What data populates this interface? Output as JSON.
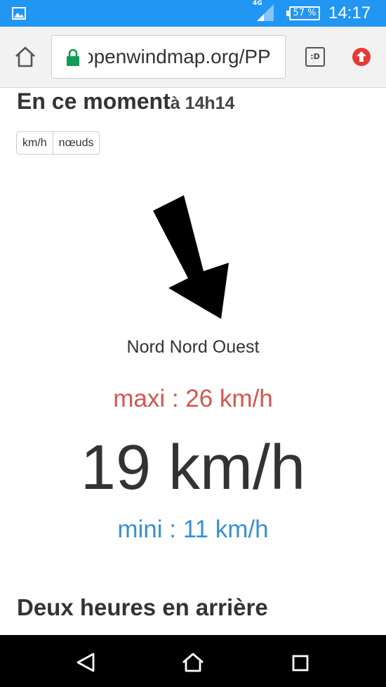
{
  "status_bar": {
    "network": "4G",
    "battery": "57 %",
    "time": "14:17"
  },
  "browser": {
    "url": "openwindmap.org/PP",
    "tabs_icon_label": ":D"
  },
  "page": {
    "heading_now": "En ce moment",
    "heading_now_time": "à 14h14",
    "units": [
      "km/h",
      "nœuds"
    ],
    "direction": "Nord Nord Ouest",
    "max": "maxi : 26 km/h",
    "speed": "19 km/h",
    "min": "mini : 11 km/h",
    "heading_back": "Deux heures en arrière"
  },
  "colors": {
    "status_bar": "#2196f3",
    "max": "#d9534f",
    "min": "#3a8fd6",
    "lock": "#0f9d58",
    "update": "#e53935"
  }
}
